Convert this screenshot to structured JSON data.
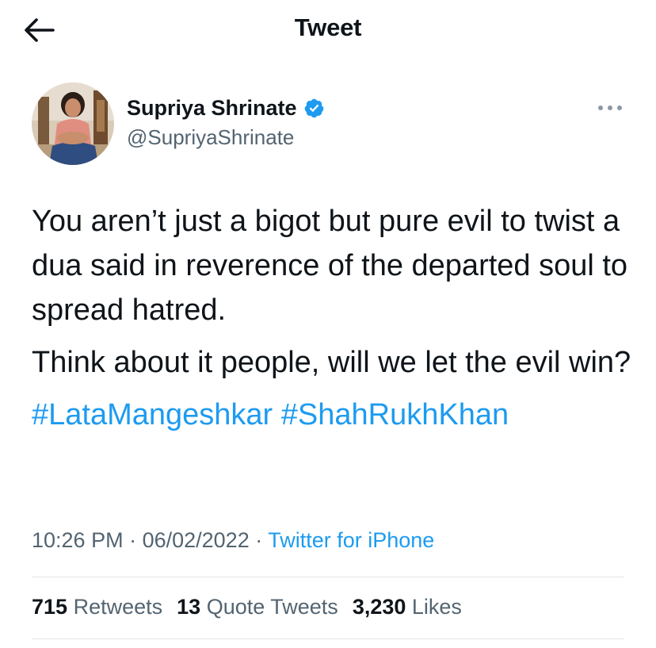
{
  "header": {
    "title": "Tweet",
    "back_icon": "arrow-left-icon"
  },
  "author": {
    "name": "Supriya Shrinate",
    "handle": "@SupriyaShrinate",
    "verified_icon": "verified-badge-icon",
    "verified_color": "#1d9bf0"
  },
  "tweet": {
    "paragraph1": "You aren’t just a bigot but pure evil to twist a dua said in reverence of the departed soul to spread hatred.",
    "paragraph2": "Think about it people, will we let the evil win?",
    "hashtags": [
      "#LataMangeshkar",
      "#ShahRukhKhan"
    ]
  },
  "meta": {
    "time": "10:26 PM",
    "separator": " · ",
    "date": "06/02/2022",
    "source": "Twitter for iPhone"
  },
  "stats": {
    "retweets_count": "715",
    "retweets_label": "Retweets",
    "quotes_count": "13",
    "quotes_label": "Quote Tweets",
    "likes_count": "3,230",
    "likes_label": "Likes"
  },
  "colors": {
    "accent": "#1d9bf0",
    "text_primary": "#0f1419",
    "text_secondary": "#536471",
    "divider": "#e1e5e8"
  }
}
